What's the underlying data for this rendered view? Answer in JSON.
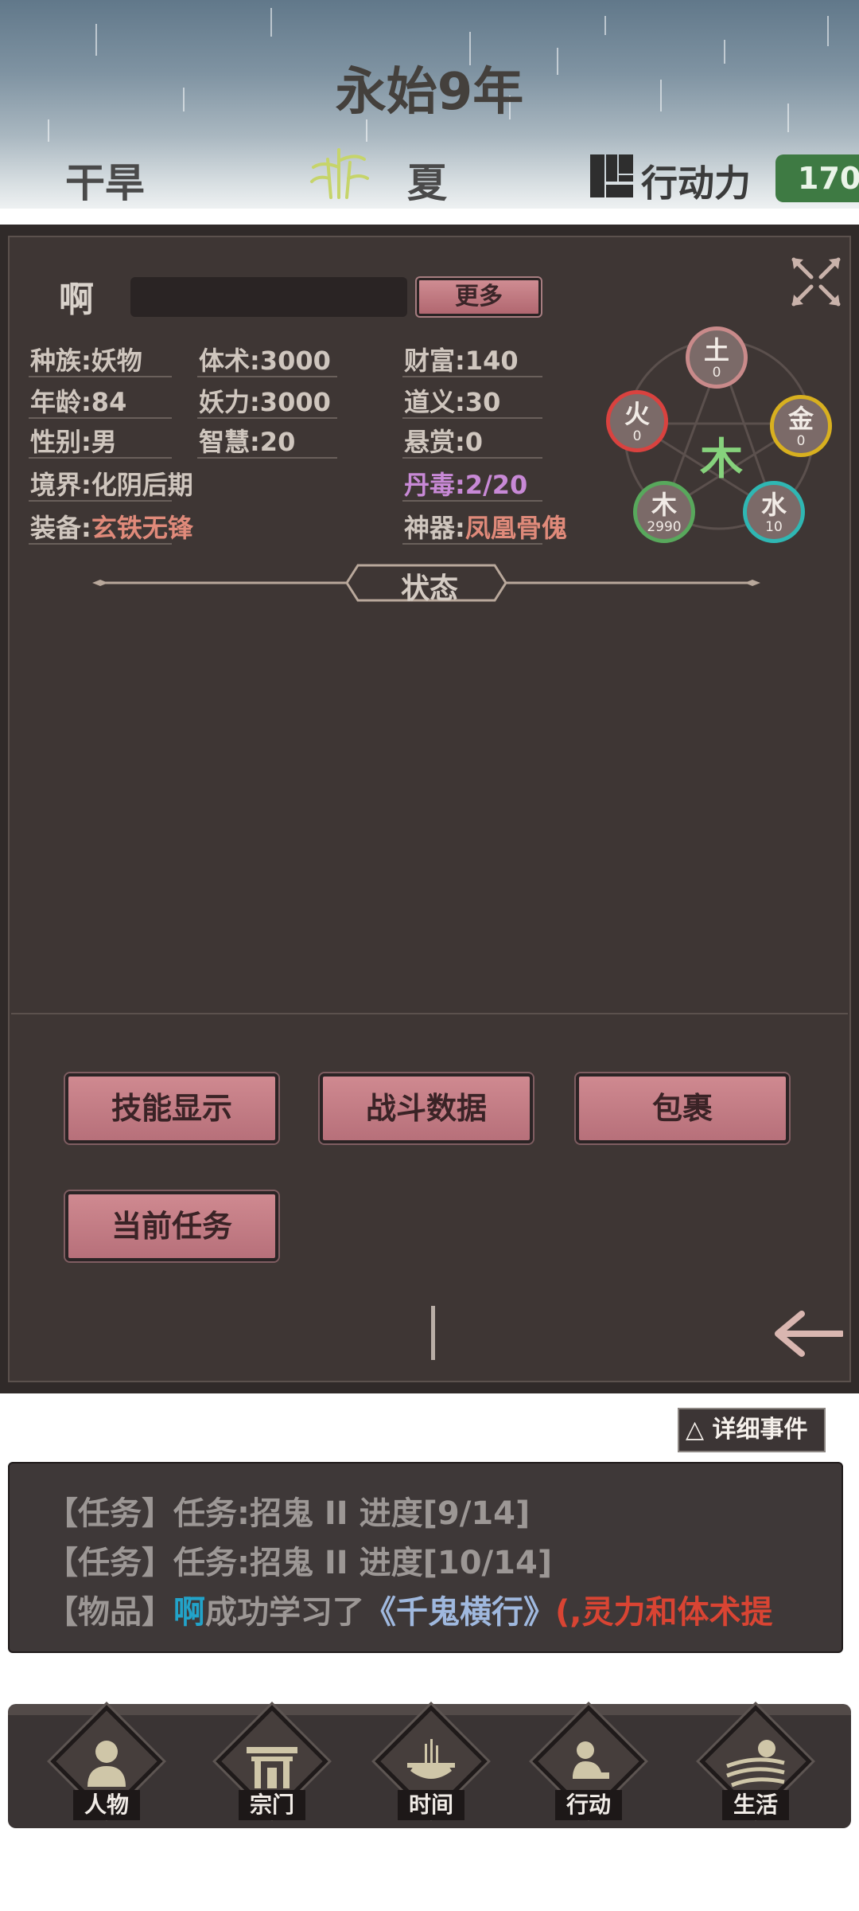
{
  "header": {
    "year": "永始9年",
    "weather": "干旱",
    "season": "夏",
    "action_label": "行动力",
    "action_points": "170"
  },
  "character": {
    "name": "啊",
    "more_button": "更多",
    "stats": {
      "race": "种族:妖物",
      "age": "年龄:84",
      "gender": "性别:男",
      "realm": "境界:化阴后期",
      "equipment_prefix": "装备:",
      "equipment": "玄铁无锋",
      "body": "体术:3000",
      "demon_power": "妖力:3000",
      "wisdom": "智慧:20",
      "wealth": "财富:140",
      "righteousness": "道义:30",
      "bounty": "悬赏:0",
      "pill_poison": "丹毒:2/20",
      "artifact_prefix": "神器:",
      "artifact": "凤凰骨傀"
    },
    "elements": {
      "center": "木",
      "earth": {
        "name": "土",
        "value": "0",
        "color": "#c98a8a"
      },
      "fire": {
        "name": "火",
        "value": "0",
        "color": "#d9423f"
      },
      "metal": {
        "name": "金",
        "value": "0",
        "color": "#d8b01f"
      },
      "wood": {
        "name": "木",
        "value": "2990",
        "color": "#58a85c"
      },
      "water": {
        "name": "水",
        "value": "10",
        "color": "#2fb7b3"
      }
    },
    "status_title": "状态"
  },
  "buttons": {
    "skills": "技能显示",
    "battle": "战斗数据",
    "bag": "包裹",
    "quest": "当前任务"
  },
  "events": {
    "toggle_label": "△ 详细事件",
    "lines": [
      {
        "tag": "【任务】",
        "text": "任务:招鬼 II 进度[9/14]"
      },
      {
        "tag": "【任务】",
        "text": "任务:招鬼 II 进度[10/14]"
      },
      {
        "tag": "【物品】",
        "name": "啊",
        "mid": "成功学习了",
        "book": "《千鬼横行》",
        "tail": "(,灵力和体术提"
      }
    ]
  },
  "nav": {
    "items": [
      "人物",
      "宗门",
      "时间",
      "行动",
      "生活"
    ]
  }
}
